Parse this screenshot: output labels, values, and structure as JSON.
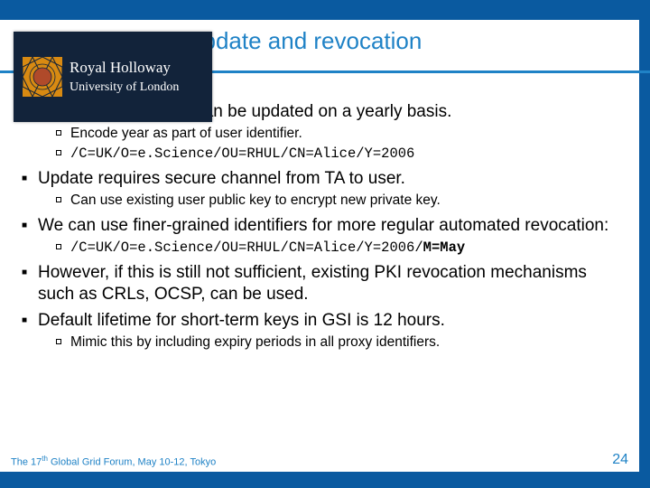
{
  "logo": {
    "line1": "Royal Holloway",
    "line2": "University of London"
  },
  "title": "Key update and revocation",
  "bullets": {
    "b1": "User long term keys can be updated on a yearly basis.",
    "b1a": "Encode year as part of user identifier.",
    "b1b": "/C=UK/O=e.Science/OU=RHUL/CN=Alice/Y=2006",
    "b2": "Update requires secure channel from TA to user.",
    "b2a": "Can use existing user public key to encrypt new private key.",
    "b3": "We can use finer-grained identifiers for more regular automated revocation:",
    "b3a_prefix": "/C=UK/O=e.Science/OU=RHUL/CN=Alice/Y=2006/",
    "b3a_bold": "M=May",
    "b4": "However, if this is still not sufficient, existing PKI revocation mechanisms such as CRLs, OCSP, can be used.",
    "b5": "Default lifetime for short-term keys in GSI is 12 hours.",
    "b5a": "Mimic this by including expiry periods in all proxy identifiers."
  },
  "footer": {
    "prefix": "The 17",
    "sup": "th",
    "rest": " Global Grid Forum, May 10-12, Tokyo"
  },
  "page": "24"
}
